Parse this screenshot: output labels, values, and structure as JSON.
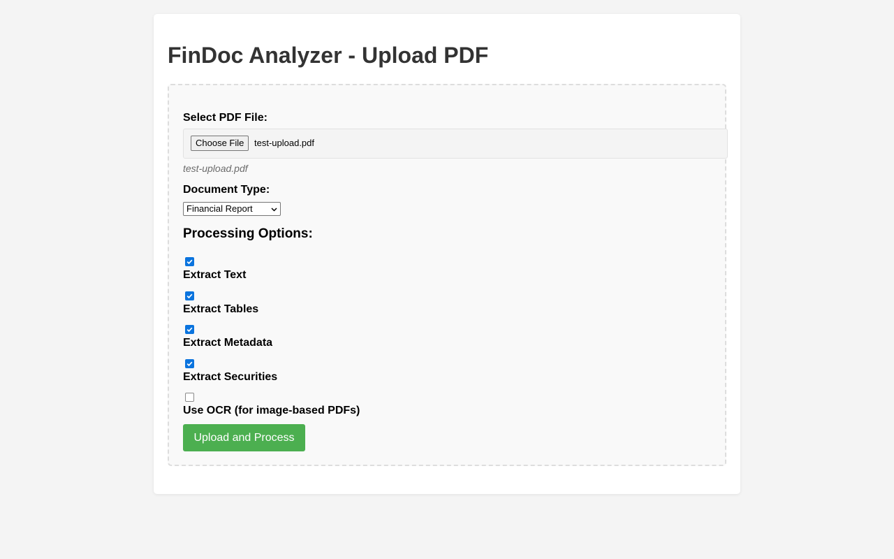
{
  "page": {
    "title": "FinDoc Analyzer - Upload PDF"
  },
  "file_input": {
    "label": "Select PDF File:",
    "button_label": "Choose File",
    "selected_file": "test-upload.pdf",
    "hint": "test-upload.pdf"
  },
  "document_type": {
    "label": "Document Type:",
    "selected": "Financial Report"
  },
  "processing": {
    "heading": "Processing Options:",
    "options": [
      {
        "label": "Extract Text",
        "checked": true
      },
      {
        "label": "Extract Tables",
        "checked": true
      },
      {
        "label": "Extract Metadata",
        "checked": true
      },
      {
        "label": "Extract Securities",
        "checked": true
      },
      {
        "label": "Use OCR (for image-based PDFs)",
        "checked": false
      }
    ]
  },
  "submit": {
    "label": "Upload and Process"
  },
  "colors": {
    "background": "#f4f4f4",
    "accent_button": "#4caf50",
    "checkbox_checked": "#0b74de",
    "title_text": "#333333"
  },
  "icons": {
    "select_arrow": "chevron-down-icon",
    "checkbox_mark": "check-icon"
  }
}
